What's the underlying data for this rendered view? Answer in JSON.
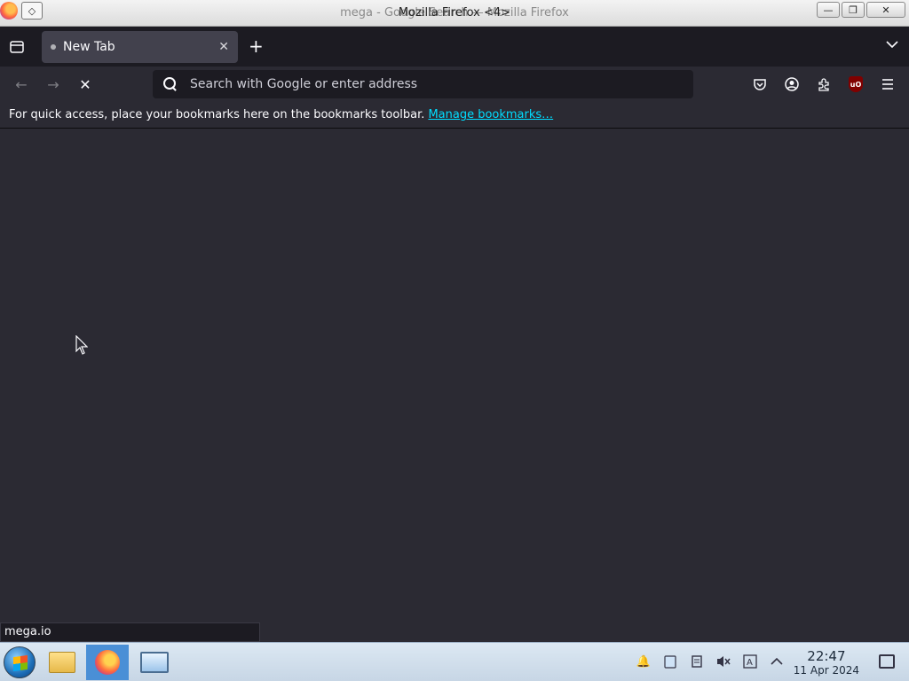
{
  "window": {
    "title_behind": "mega - Google Search — Mozilla Firefox",
    "title_front": "Mozilla Firefox <4>",
    "minimize_glyph": "—",
    "restore_glyph": "❐",
    "close_glyph": "✕"
  },
  "tabs": [
    {
      "label": "New Tab",
      "close_glyph": "✕"
    }
  ],
  "new_tab_glyph": "+",
  "urlbar": {
    "placeholder": "Search with Google or enter address",
    "value": ""
  },
  "nav": {
    "back_glyph": "←",
    "forward_glyph": "→",
    "stop_glyph": "✕"
  },
  "toolbar_icons": [
    "pocket-icon",
    "account-icon",
    "extensions-icon",
    "ublock-origin-icon",
    "menu-icon"
  ],
  "ublock_label": "uO",
  "bookmarks_bar": {
    "text": "For quick access, place your bookmarks here on the bookmarks toolbar.",
    "link": "Manage bookmarks…"
  },
  "status_panel": "mega.io",
  "taskbar": {
    "clock_time": "22:47",
    "clock_date": "11 Apr 2024"
  },
  "colors": {
    "chrome_dark": "#1c1b22",
    "page_bg": "#2b2a33",
    "link": "#00ddff"
  }
}
